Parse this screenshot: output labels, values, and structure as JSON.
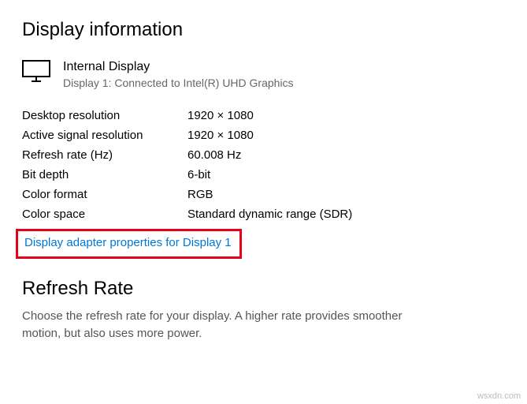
{
  "section_title": "Display information",
  "display": {
    "name": "Internal Display",
    "subtitle": "Display 1: Connected to Intel(R) UHD Graphics"
  },
  "properties": [
    {
      "label": "Desktop resolution",
      "value": "1920 × 1080"
    },
    {
      "label": "Active signal resolution",
      "value": "1920 × 1080"
    },
    {
      "label": "Refresh rate (Hz)",
      "value": "60.008 Hz"
    },
    {
      "label": "Bit depth",
      "value": "6-bit"
    },
    {
      "label": "Color format",
      "value": "RGB"
    },
    {
      "label": "Color space",
      "value": "Standard dynamic range (SDR)"
    }
  ],
  "adapter_link": "Display adapter properties for Display 1",
  "refresh_rate": {
    "heading": "Refresh Rate",
    "description": "Choose the refresh rate for your display. A higher rate provides smoother motion, but also uses more power."
  },
  "watermark": "wsxdn.com"
}
